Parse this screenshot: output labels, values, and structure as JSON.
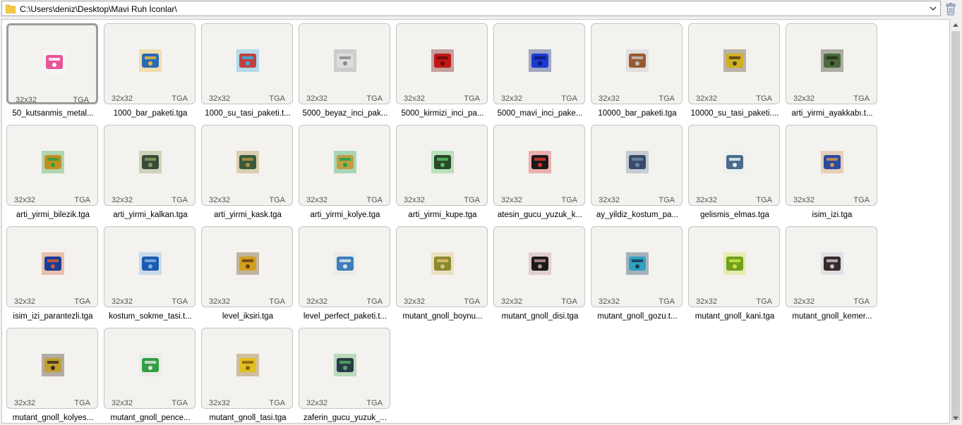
{
  "path": "C:\\Users\\deniz\\Desktop\\Mavi Ruh İconlar\\",
  "colors": {
    "folder": "#f5c842",
    "accent": "#9c9c9c"
  },
  "selected_index": 0,
  "files": [
    {
      "name": "50_kutsanmis_metal...",
      "size": "32x32",
      "format": "TGA",
      "icon": "pink-box-icon",
      "c1": "#e8559a",
      "c2": "#ffffff"
    },
    {
      "name": "1000_bar_paketi.tga",
      "size": "32x32",
      "format": "TGA",
      "icon": "blue-chest-icon",
      "c1": "#2a6bb5",
      "c2": "#e8b93c"
    },
    {
      "name": "1000_su_tasi_paketi.t...",
      "size": "32x32",
      "format": "TGA",
      "icon": "treasure-chest-icon",
      "c1": "#c04040",
      "c2": "#3ab0e0"
    },
    {
      "name": "5000_beyaz_inci_pak...",
      "size": "32x32",
      "format": "TGA",
      "icon": "white-box-icon",
      "c1": "#dcdcdc",
      "c2": "#8a8a8a"
    },
    {
      "name": "5000_kirmizi_inci_pa...",
      "size": "32x32",
      "format": "TGA",
      "icon": "red-box-icon",
      "c1": "#c01818",
      "c2": "#6a0a0a"
    },
    {
      "name": "5000_mavi_inci_pake...",
      "size": "32x32",
      "format": "TGA",
      "icon": "blue-box-icon",
      "c1": "#1a3ad0",
      "c2": "#0a1a70"
    },
    {
      "name": "10000_bar_paketi.tga",
      "size": "32x32",
      "format": "TGA",
      "icon": "wooden-chest-icon",
      "c1": "#9a5a30",
      "c2": "#c0c0c0"
    },
    {
      "name": "10000_su_tasi_paketi....",
      "size": "32x32",
      "format": "TGA",
      "icon": "gold-chest-icon",
      "c1": "#d0b020",
      "c2": "#504020"
    },
    {
      "name": "arti_yirmi_ayakkabı.t...",
      "size": "32x32",
      "format": "TGA",
      "icon": "boots-icon",
      "c1": "#4a6a3a",
      "c2": "#2a2a1a"
    },
    {
      "name": "arti_yirmi_bilezik.tga",
      "size": "32x32",
      "format": "TGA",
      "icon": "bracelet-icon",
      "c1": "#c09020",
      "c2": "#30a040"
    },
    {
      "name": "arti_yirmi_kalkan.tga",
      "size": "32x32",
      "format": "TGA",
      "icon": "shield-icon",
      "c1": "#3a4a3a",
      "c2": "#8a9a5a"
    },
    {
      "name": "arti_yirmi_kask.tga",
      "size": "32x32",
      "format": "TGA",
      "icon": "helmet-icon",
      "c1": "#3a5a3a",
      "c2": "#b09040"
    },
    {
      "name": "arti_yirmi_kolye.tga",
      "size": "32x32",
      "format": "TGA",
      "icon": "necklace-icon",
      "c1": "#c0a040",
      "c2": "#20a050"
    },
    {
      "name": "arti_yirmi_kupe.tga",
      "size": "32x32",
      "format": "TGA",
      "icon": "earring-icon",
      "c1": "#2a4a2a",
      "c2": "#50c060"
    },
    {
      "name": "atesin_gucu_yuzuk_k...",
      "size": "32x32",
      "format": "TGA",
      "icon": "fire-ring-icon",
      "c1": "#1a1a1a",
      "c2": "#e03030"
    },
    {
      "name": "ay_yildiz_kostum_pa...",
      "size": "32x32",
      "format": "TGA",
      "icon": "costume-icon",
      "c1": "#3a4a6a",
      "c2": "#6a8aa0"
    },
    {
      "name": "gelismis_elmas.tga",
      "size": "32x32",
      "format": "TGA",
      "icon": "diamond-icon",
      "c1": "#4a6a8a",
      "c2": "#e0f0f0"
    },
    {
      "name": "isim_izi.tga",
      "size": "32x32",
      "format": "TGA",
      "icon": "scroll-icon",
      "c1": "#2a4aa0",
      "c2": "#d09050"
    },
    {
      "name": "isim_izi_parantezli.tga",
      "size": "32x32",
      "format": "TGA",
      "icon": "quill-icon",
      "c1": "#1a3a9a",
      "c2": "#d06030"
    },
    {
      "name": "kostum_sokme_tasi.t...",
      "size": "32x32",
      "format": "TGA",
      "icon": "blue-gem-icon",
      "c1": "#1a5ab0",
      "c2": "#7ab0e0"
    },
    {
      "name": "level_iksiri.tga",
      "size": "32x32",
      "format": "TGA",
      "icon": "gold-coins-icon",
      "c1": "#d0a020",
      "c2": "#6a4010"
    },
    {
      "name": "level_perfect_paketi.t...",
      "size": "32x32",
      "format": "TGA",
      "icon": "bucket-icon",
      "c1": "#3a80c0",
      "c2": "#e0e0e0"
    },
    {
      "name": "mutant_gnoll_boynu...",
      "size": "32x32",
      "format": "TGA",
      "icon": "horn-icon",
      "c1": "#8a8a30",
      "c2": "#e0c070"
    },
    {
      "name": "mutant_gnoll_disi.tga",
      "size": "32x32",
      "format": "TGA",
      "icon": "tooth-icon",
      "c1": "#1a1a1a",
      "c2": "#c09090"
    },
    {
      "name": "mutant_gnoll_gozu.t...",
      "size": "32x32",
      "format": "TGA",
      "icon": "eye-icon",
      "c1": "#30a0c0",
      "c2": "#1a3a5a"
    },
    {
      "name": "mutant_gnoll_kani.tga",
      "size": "32x32",
      "format": "TGA",
      "icon": "potion-icon",
      "c1": "#70a020",
      "c2": "#d0e040"
    },
    {
      "name": "mutant_gnoll_kemer...",
      "size": "32x32",
      "format": "TGA",
      "icon": "belt-icon",
      "c1": "#3a2a2a",
      "c2": "#c0c0d0"
    },
    {
      "name": "mutant_gnoll_kolyes...",
      "size": "32x32",
      "format": "TGA",
      "icon": "teeth-necklace-icon",
      "c1": "#c0a030",
      "c2": "#3a2a1a"
    },
    {
      "name": "mutant_gnoll_pence...",
      "size": "32x32",
      "format": "TGA",
      "icon": "claw-icon",
      "c1": "#30a040",
      "c2": "#e0e0e0"
    },
    {
      "name": "mutant_gnoll_tasi.tga",
      "size": "32x32",
      "format": "TGA",
      "icon": "gold-stone-icon",
      "c1": "#e0c020",
      "c2": "#8a6010"
    },
    {
      "name": "zaferin_gucu_yuzuk_...",
      "size": "32x32",
      "format": "TGA",
      "icon": "victory-ring-icon",
      "c1": "#2a3a4a",
      "c2": "#50b060"
    }
  ]
}
